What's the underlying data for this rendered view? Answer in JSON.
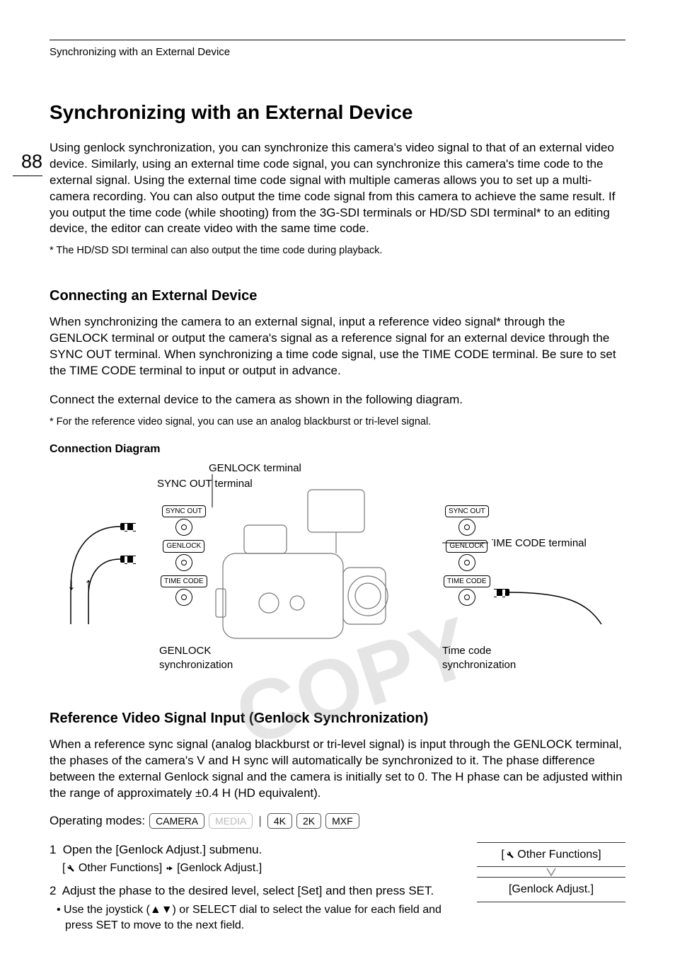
{
  "running_head": "Synchronizing with an External Device",
  "page_number": "88",
  "h1": "Synchronizing with an External Device",
  "intro_p": "Using genlock synchronization, you can synchronize this camera's video signal to that of an external video device. Similarly, using an external time code signal, you can synchronize this camera's time code to the external signal. Using the external time code signal with multiple cameras allows you to set up a multi-camera recording. You can also output the time code signal from this camera to achieve the same result. If you output the time code (while shooting) from the 3G-SDI terminals or HD/SD SDI terminal* to an editing device, the editor can create video with the same time code.",
  "intro_footnote": "* The HD/SD SDI terminal can also output the time code during playback.",
  "sec1_h": "Connecting an External Device",
  "sec1_p1": "When synchronizing the camera to an external signal, input a reference video signal* through the GENLOCK terminal or output the camera's signal as a reference signal for an external device through the SYNC OUT terminal. When synchronizing a time code signal, use the TIME CODE terminal. Be sure to set the TIME CODE terminal to input or output in advance.",
  "sec1_p2": "Connect the external device to the camera as shown in the following diagram.",
  "sec1_footnote": "* For the reference video signal, you can use an analog blackburst or tri-level signal.",
  "diagram_title": "Connection Diagram",
  "diagram": {
    "label_genlock_term": "GENLOCK terminal",
    "label_syncout_term": "SYNC OUT terminal",
    "label_timecode_term": "TIME CODE terminal",
    "label_genlock_sync": "GENLOCK\nsynchronization",
    "label_timecode_sync": "Time code\nsynchronization",
    "port_syncout": "SYNC OUT",
    "port_genlock": "GENLOCK",
    "port_timecode": "TIME CODE"
  },
  "watermark": "COPY",
  "sec2_h": "Reference Video Signal Input (Genlock Synchronization)",
  "sec2_p": "When a reference sync signal (analog blackburst or tri-level signal) is input through the GENLOCK terminal, the phases of the camera's V and H sync will automatically be synchronized to it. The phase difference between the external Genlock signal and the camera is initially set to 0. The H phase can be adjusted within the range of approximately ±0.4 H (HD equivalent).",
  "opmodes_label": "Operating modes:",
  "opmodes": {
    "camera": "CAMERA",
    "media": "MEDIA",
    "k4": "4K",
    "k2": "2K",
    "mxf": "MXF"
  },
  "steps": {
    "s1": "Open the [Genlock Adjust.] submenu.",
    "s1_path_a": " Other Functions] ",
    "s1_path_b": " [Genlock Adjust.]",
    "s2": "Adjust the phase to the desired level, select [Set] and then press SET.",
    "s2_bullet": "Use the joystick (▲▼) or SELECT dial to select the value for each field and press SET to move to the next field."
  },
  "menu_path": {
    "box1": " Other Functions]",
    "box2": "[Genlock Adjust.]"
  }
}
